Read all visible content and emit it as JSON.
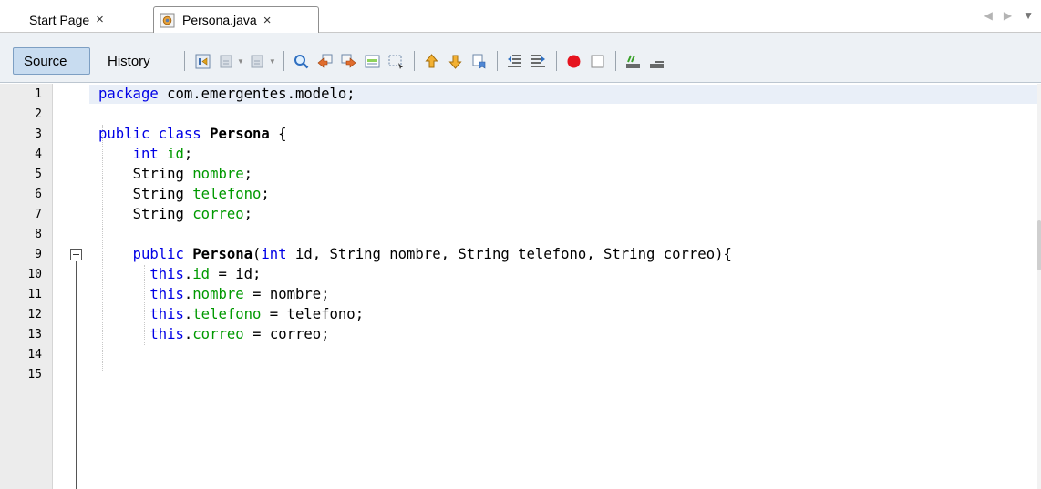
{
  "tabs": [
    {
      "label": "Start Page",
      "close": "×",
      "active": false
    },
    {
      "label": "Persona.java",
      "close": "×",
      "active": true,
      "icon": "java-file-icon"
    }
  ],
  "tab_nav": {
    "prev": "◀",
    "next": "▶",
    "dropdown": "▼"
  },
  "toolbar": {
    "source_label": "Source",
    "history_label": "History",
    "icons": [
      "last-edit-icon",
      "back-icon",
      "forward-icon",
      "find-selection-icon",
      "find-previous-icon",
      "find-next-icon",
      "toggle-highlight-icon",
      "rectangular-selection-icon",
      "previous-bookmark-icon",
      "next-bookmark-icon",
      "toggle-bookmark-icon",
      "shift-left-icon",
      "shift-right-icon",
      "start-macro-icon",
      "stop-macro-icon",
      "comment-icon",
      "uncomment-icon"
    ]
  },
  "colors": {
    "keyword": "#0000e6",
    "field": "#009900",
    "gutter": "#ececec",
    "current_line": "#e9eff8",
    "macro_record": "#e6141e"
  },
  "editor": {
    "language": "java",
    "lines": [
      {
        "n": "1",
        "text": "package com.emergentes.modelo;"
      },
      {
        "n": "2",
        "text": ""
      },
      {
        "n": "3",
        "text": "public class Persona {"
      },
      {
        "n": "4",
        "text": "    int id;"
      },
      {
        "n": "5",
        "text": "    String nombre;"
      },
      {
        "n": "6",
        "text": "    String telefono;"
      },
      {
        "n": "7",
        "text": "    String correo;"
      },
      {
        "n": "8",
        "text": ""
      },
      {
        "n": "9",
        "text": "    public Persona(int id, String nombre, String telefono, String correo){"
      },
      {
        "n": "10",
        "text": "      this.id = id;"
      },
      {
        "n": "11",
        "text": "      this.nombre = nombre;"
      },
      {
        "n": "12",
        "text": "      this.telefono = telefono;"
      },
      {
        "n": "13",
        "text": "      this.correo = correo;"
      },
      {
        "n": "14",
        "text": ""
      },
      {
        "n": "15",
        "text": ""
      }
    ]
  }
}
